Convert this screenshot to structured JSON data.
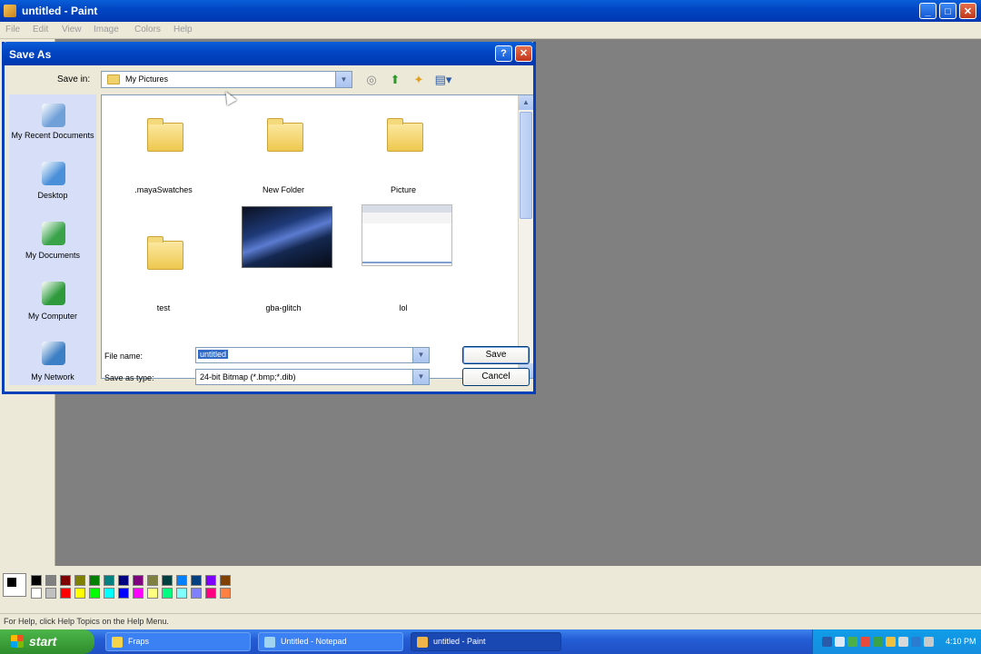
{
  "paint": {
    "title": "untitled - Paint",
    "menu": [
      "File",
      "Edit",
      "View",
      "Image",
      "Colors",
      "Help"
    ],
    "status": "For Help, click Help Topics on the Help Menu.",
    "palette_row1": [
      "#000000",
      "#808080",
      "#800000",
      "#808000",
      "#008000",
      "#008080",
      "#000080",
      "#800080",
      "#808040",
      "#004040",
      "#0080ff",
      "#004080",
      "#8000ff",
      "#804000"
    ],
    "palette_row2": [
      "#ffffff",
      "#c0c0c0",
      "#ff0000",
      "#ffff00",
      "#00ff00",
      "#00ffff",
      "#0000ff",
      "#ff00ff",
      "#ffff80",
      "#00ff80",
      "#80ffff",
      "#8080ff",
      "#ff0080",
      "#ff8040"
    ]
  },
  "dialog": {
    "title": "Save As",
    "save_in_label": "Save in:",
    "save_in_value": "My Pictures",
    "places": [
      {
        "label": "My Recent Documents",
        "icon": "recent-documents-icon",
        "color": "#6fa0d8"
      },
      {
        "label": "Desktop",
        "icon": "desktop-icon",
        "color": "#4a90d9"
      },
      {
        "label": "My Documents",
        "icon": "my-documents-icon",
        "color": "#3aa34a"
      },
      {
        "label": "My Computer",
        "icon": "my-computer-icon",
        "color": "#2e9a3c"
      },
      {
        "label": "My Network",
        "icon": "my-network-icon",
        "color": "#3d7fc4"
      }
    ],
    "files": [
      {
        "name": ".mayaSwatches",
        "type": "folder"
      },
      {
        "name": "New Folder",
        "type": "folder"
      },
      {
        "name": "Picture",
        "type": "folder"
      },
      {
        "name": "test",
        "type": "folder"
      },
      {
        "name": "gba-glitch",
        "type": "image"
      },
      {
        "name": "lol",
        "type": "image"
      }
    ],
    "file_name_label": "File name:",
    "file_name_value": "untitled",
    "save_type_label": "Save as type:",
    "save_type_value": "24-bit Bitmap (*.bmp;*.dib)",
    "save_button": "Save",
    "cancel_button": "Cancel"
  },
  "taskbar": {
    "start": "start",
    "tasks": [
      "Fraps",
      "Untitled - Notepad",
      "untitled - Paint"
    ],
    "clock": "4:10 PM"
  }
}
